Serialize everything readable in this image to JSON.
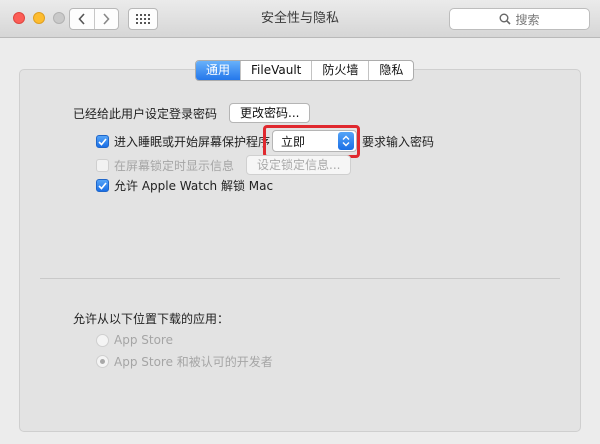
{
  "window": {
    "title": "安全性与隐私"
  },
  "toolbar": {
    "back_icon": "chevron-left-icon",
    "forward_icon": "chevron-right-icon",
    "grid_icon": "grid-icon",
    "search_placeholder": "搜索"
  },
  "tabs": [
    {
      "label": "通用",
      "active": true
    },
    {
      "label": "FileVault",
      "active": false
    },
    {
      "label": "防火墙",
      "active": false
    },
    {
      "label": "隐私",
      "active": false
    }
  ],
  "general": {
    "password_set_label": "已经给此用户设定登录密码",
    "change_password_button": "更改密码...",
    "require_password": {
      "checked": true,
      "label_before": "进入睡眠或开始屏幕保护程序",
      "selected_option": "立即",
      "label_after": "要求输入密码"
    },
    "show_message": {
      "checked": false,
      "enabled": false,
      "label": "在屏幕锁定时显示信息",
      "button": "设定锁定信息..."
    },
    "apple_watch": {
      "checked": true,
      "label": "允许 Apple Watch 解锁 Mac"
    }
  },
  "downloads": {
    "heading": "允许从以下位置下载的应用：",
    "options": [
      {
        "label": "App Store",
        "selected": false
      },
      {
        "label": "App Store 和被认可的开发者",
        "selected": true
      }
    ]
  },
  "colors": {
    "accent": "#2477eb",
    "highlight_box": "#e0292f"
  }
}
